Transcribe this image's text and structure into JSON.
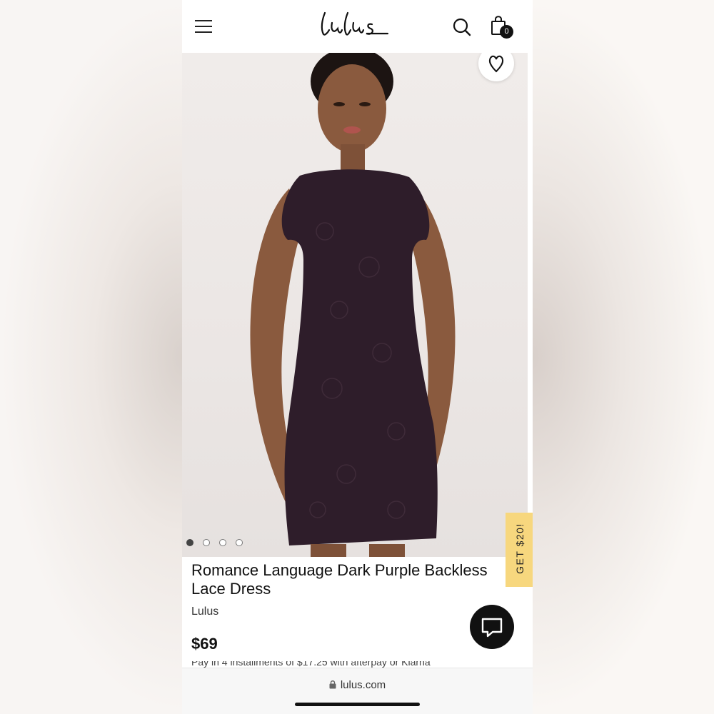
{
  "header": {
    "logo_text": "Lulus",
    "cart_count": "0",
    "menu_icon": "hamburger-icon",
    "search_icon": "search-icon",
    "cart_icon": "shopping-bag-icon"
  },
  "product": {
    "title": "Romance Language Dark Purple Backless Lace Dress",
    "brand": "Lulus",
    "price": "$69",
    "installments_text": "Pay in 4 installments of $17.25 with afterpay or Klarna",
    "image_count": 4,
    "active_image_index": 0,
    "dress_color": "#2e1d2a"
  },
  "promo": {
    "label": "GET $20!",
    "color": "#f7d77e"
  },
  "browser": {
    "url": "lulus.com",
    "lock_icon": "lock-icon"
  },
  "icons": {
    "favorite": "heart-icon",
    "chat": "chat-icon"
  }
}
